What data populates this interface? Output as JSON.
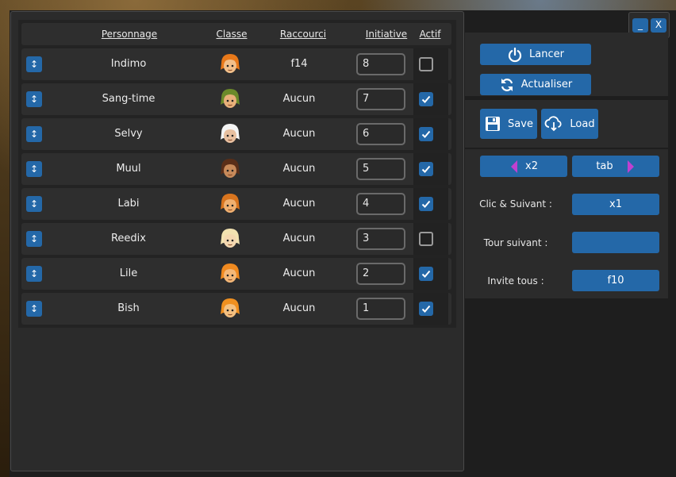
{
  "table": {
    "headers": {
      "personnage": "Personnage",
      "classe": "Classe",
      "raccourci": "Raccourci",
      "initiative": "Initiative",
      "actif": "Actif"
    },
    "rows": [
      {
        "name": "Indimo",
        "shortcut": "f14",
        "initiative": "8",
        "active": false,
        "hair": "#e8791a",
        "skin": "#f2c08a"
      },
      {
        "name": "Sang-time",
        "shortcut": "Aucun",
        "initiative": "7",
        "active": true,
        "hair": "#6b8a2a",
        "skin": "#e8b07a"
      },
      {
        "name": "Selvy",
        "shortcut": "Aucun",
        "initiative": "6",
        "active": true,
        "hair": "#f4f4f4",
        "skin": "#e8c0a0"
      },
      {
        "name": "Muul",
        "shortcut": "Aucun",
        "initiative": "5",
        "active": true,
        "hair": "#5a2e18",
        "skin": "#c88a5a"
      },
      {
        "name": "Labi",
        "shortcut": "Aucun",
        "initiative": "4",
        "active": true,
        "hair": "#d8741e",
        "skin": "#f0b070"
      },
      {
        "name": "Reedix",
        "shortcut": "Aucun",
        "initiative": "3",
        "active": false,
        "hair": "#f2e2b0",
        "skin": "#f4d8b0"
      },
      {
        "name": "Lile",
        "shortcut": "Aucun",
        "initiative": "2",
        "active": true,
        "hair": "#f08a20",
        "skin": "#f4b878"
      },
      {
        "name": "Bish",
        "shortcut": "Aucun",
        "initiative": "1",
        "active": true,
        "hair": "#f09020",
        "skin": "#f4c080"
      }
    ]
  },
  "window": {
    "minimize": "_",
    "close": "X"
  },
  "actions": {
    "launch": "Lancer",
    "refresh": "Actualiser",
    "save": "Save",
    "load": "Load",
    "multiplier": "x2",
    "tab": "tab"
  },
  "settings": {
    "clic_suivant_label": "Clic & Suivant :",
    "clic_suivant_value": "x1",
    "tour_suivant_label": "Tour suivant :",
    "tour_suivant_value": "",
    "invite_tous_label": "Invite tous :",
    "invite_tous_value": "f10"
  },
  "colors": {
    "accent": "#2468a8",
    "arrow": "#c040d0"
  }
}
